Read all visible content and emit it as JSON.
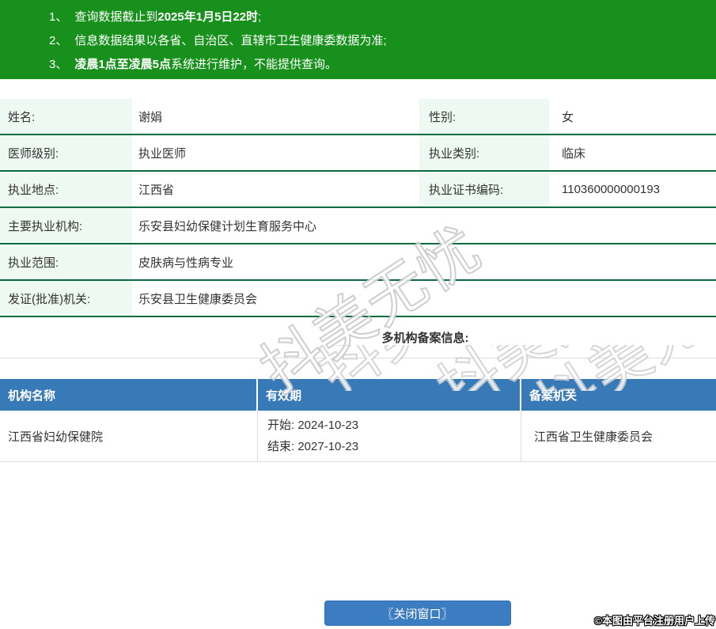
{
  "colors": {
    "banner_green": "#17911c",
    "row_line_green": "#0c6b40",
    "label_bg_mint": "#edf9f2",
    "table_header_blue": "#3879b8",
    "button_blue": "#3b7dc0",
    "divider_gray": "#dddddd"
  },
  "notice": {
    "lines": [
      {
        "num": "1、",
        "pre": "查询数据截止到",
        "bold": "2025年1月5日22时",
        "post": ";"
      },
      {
        "num": "2、",
        "pre": "信息数据结果以各省、自治区、直辖市卫生健康委数据为准;",
        "bold": "",
        "post": ""
      },
      {
        "num": "3、",
        "pre": "",
        "bold": "凌晨1点至凌晨5点",
        "post": "系统进行维护，不能提供查询。"
      }
    ]
  },
  "profile": {
    "rows": [
      {
        "label": "姓名:",
        "value": "谢娟",
        "label2": "性别:",
        "value2": "女"
      },
      {
        "label": "医师级别:",
        "value": "执业医师",
        "label2": "执业类别:",
        "value2": "临床"
      },
      {
        "label": "执业地点:",
        "value": "江西省",
        "label2": "执业证书编码:",
        "value2": "110360000000193"
      },
      {
        "label": "主要执业机构:",
        "value": "乐安县妇幼保健计划生育服务中心"
      },
      {
        "label": "执业范围:",
        "value": "皮肤病与性病专业"
      },
      {
        "label": "发证(批准)机关:",
        "value": "乐安县卫生健康委员会"
      }
    ]
  },
  "filing": {
    "section_title": "多机构备案信息:",
    "headers": [
      "机构名称",
      "有效期",
      "备案机关"
    ],
    "rows": [
      {
        "org": "江西省妇幼保健院",
        "valid_start": "开始: 2024-10-23",
        "valid_end": "结束: 2027-10-23",
        "authority": "江西省卫生健康委员会"
      }
    ]
  },
  "footer": {
    "close_button": "〖关闭窗口〗",
    "copyright": "©本图由平台注册用户上传"
  },
  "watermark": {
    "text": "抖美无忧"
  }
}
